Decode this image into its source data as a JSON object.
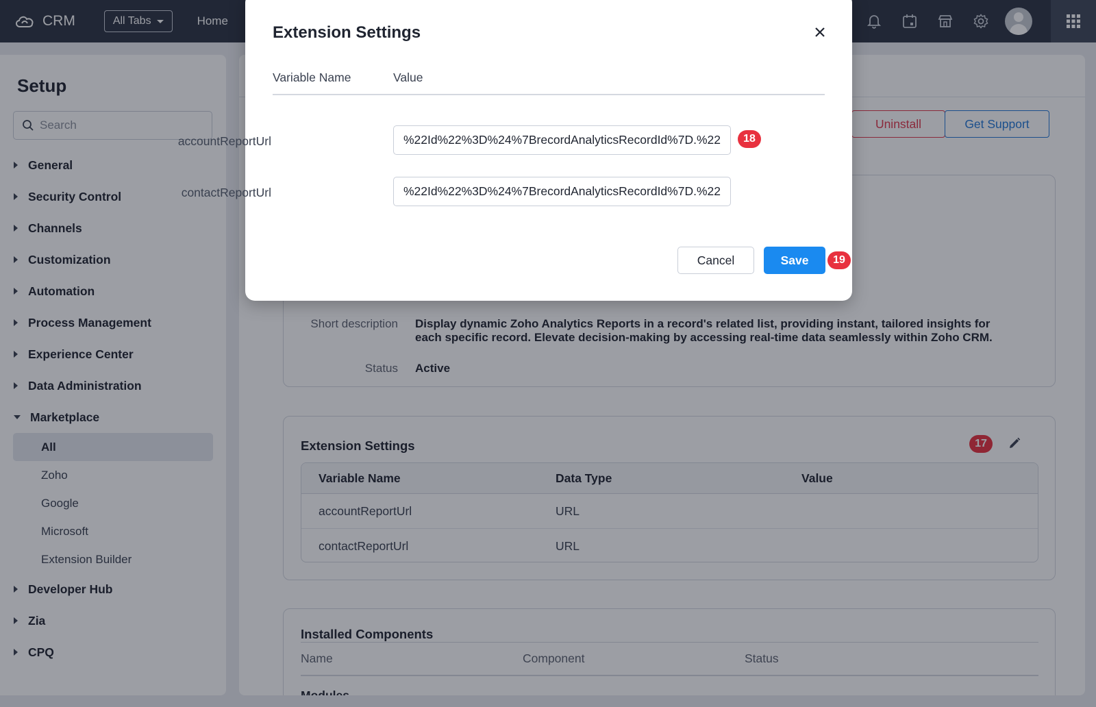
{
  "topbar": {
    "app_name": "CRM",
    "all_tabs_label": "All Tabs",
    "home_label": "Home",
    "icons": [
      "bell-icon",
      "calendar-icon",
      "marketplace-icon",
      "gear-icon"
    ]
  },
  "sidebar": {
    "title": "Setup",
    "search_placeholder": "Search",
    "items": [
      {
        "label": "General"
      },
      {
        "label": "Security Control"
      },
      {
        "label": "Channels"
      },
      {
        "label": "Customization"
      },
      {
        "label": "Automation"
      },
      {
        "label": "Process Management"
      },
      {
        "label": "Experience Center"
      },
      {
        "label": "Data Administration"
      },
      {
        "label": "Marketplace"
      },
      {
        "label": "Developer Hub"
      },
      {
        "label": "Zia"
      },
      {
        "label": "CPQ"
      }
    ],
    "marketplace_sub": [
      "All",
      "Zoho",
      "Google",
      "Microsoft",
      "Extension Builder"
    ]
  },
  "main": {
    "uninstall_label": "Uninstall",
    "get_support_label": "Get Support",
    "short_description_label": "Short description",
    "short_description_value": "Display dynamic Zoho Analytics Reports in a record's related list, providing instant, tailored insights for each specific record. Elevate decision-making by accessing real-time data seamlessly within Zoho CRM.",
    "status_label": "Status",
    "status_value": "Active",
    "extension_settings": {
      "title": "Extension Settings",
      "badge": "17",
      "columns": [
        "Variable Name",
        "Data Type",
        "Value"
      ],
      "rows": [
        {
          "name": "accountReportUrl",
          "type": "URL",
          "value": ""
        },
        {
          "name": "contactReportUrl",
          "type": "URL",
          "value": ""
        }
      ]
    },
    "installed_components": {
      "title": "Installed Components",
      "columns": [
        "Name",
        "Component",
        "Status"
      ],
      "partial_row": "Modules"
    }
  },
  "modal": {
    "title": "Extension Settings",
    "col_variable": "Variable Name",
    "col_value": "Value",
    "rows": [
      {
        "label": "accountReportUrl",
        "value": "%22.%22Id%22%3D%24%7BrecordAnalyticsRecordId%7D",
        "badge": "18"
      },
      {
        "label": "contactReportUrl",
        "value": "%22.%22Id%22%3D%24%7BrecordAnalyticsRecordId%7D",
        "badge": ""
      }
    ],
    "cancel_label": "Cancel",
    "save_label": "Save",
    "save_badge": "19"
  }
}
